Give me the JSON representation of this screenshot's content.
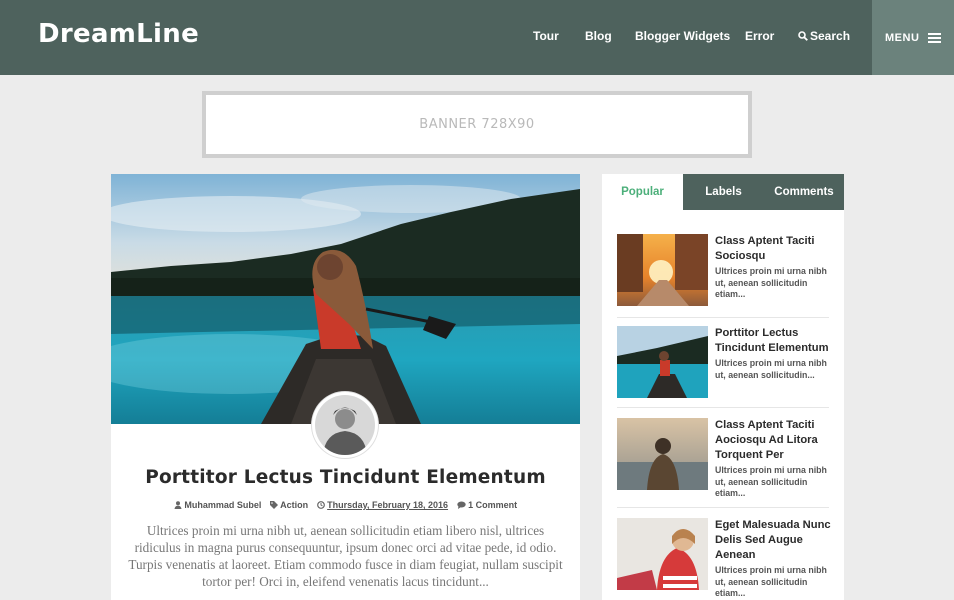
{
  "header": {
    "logo": "DreamLine",
    "nav": [
      "Tour",
      "Blog",
      "Blogger Widgets",
      "Error"
    ],
    "search_label": "Search",
    "menu_label": "MENU",
    "bg_color": "#4e625d"
  },
  "banner": {
    "text": "BANNER 728X90"
  },
  "post": {
    "title": "Porttitor Lectus Tincidunt Elementum",
    "author": "Muhammad Subel",
    "label": "Action",
    "date": "Thursday, February 18, 2016",
    "comments": "1 Comment",
    "excerpt": "Ultrices proin mi urna nibh ut, aenean sollicitudin etiam libero nisl, ultrices ridiculus in magna purus consequuntur, ipsum donec orci ad vitae pede, id odio. Turpis venenatis at laoreet. Etiam commodo fusce in diam feugiat, nullam suscipit tortor per! Orci in, eleifend venenatis lacus tincidunt..."
  },
  "sidebar": {
    "tabs": [
      "Popular",
      "Labels",
      "Comments"
    ],
    "accent": "#4caf7a",
    "items": [
      {
        "title": "Class Aptent Taciti Sociosqu",
        "excerpt": "Ultrices proin mi urna nibh ut, aenean sollicitudin etiam..."
      },
      {
        "title": "Porttitor Lectus Tincidunt Elementum",
        "excerpt": "Ultrices proin mi urna nibh ut, aenean sollicitudin..."
      },
      {
        "title": "Class Aptent Taciti Aociosqu Ad Litora Torquent Per",
        "excerpt": "Ultrices proin mi urna nibh ut, aenean sollicitudin etiam..."
      },
      {
        "title": "Eget Malesuada Nunc Delis Sed Augue Aenean",
        "excerpt": "Ultrices proin mi urna nibh ut, aenean sollicitudin etiam..."
      }
    ]
  }
}
